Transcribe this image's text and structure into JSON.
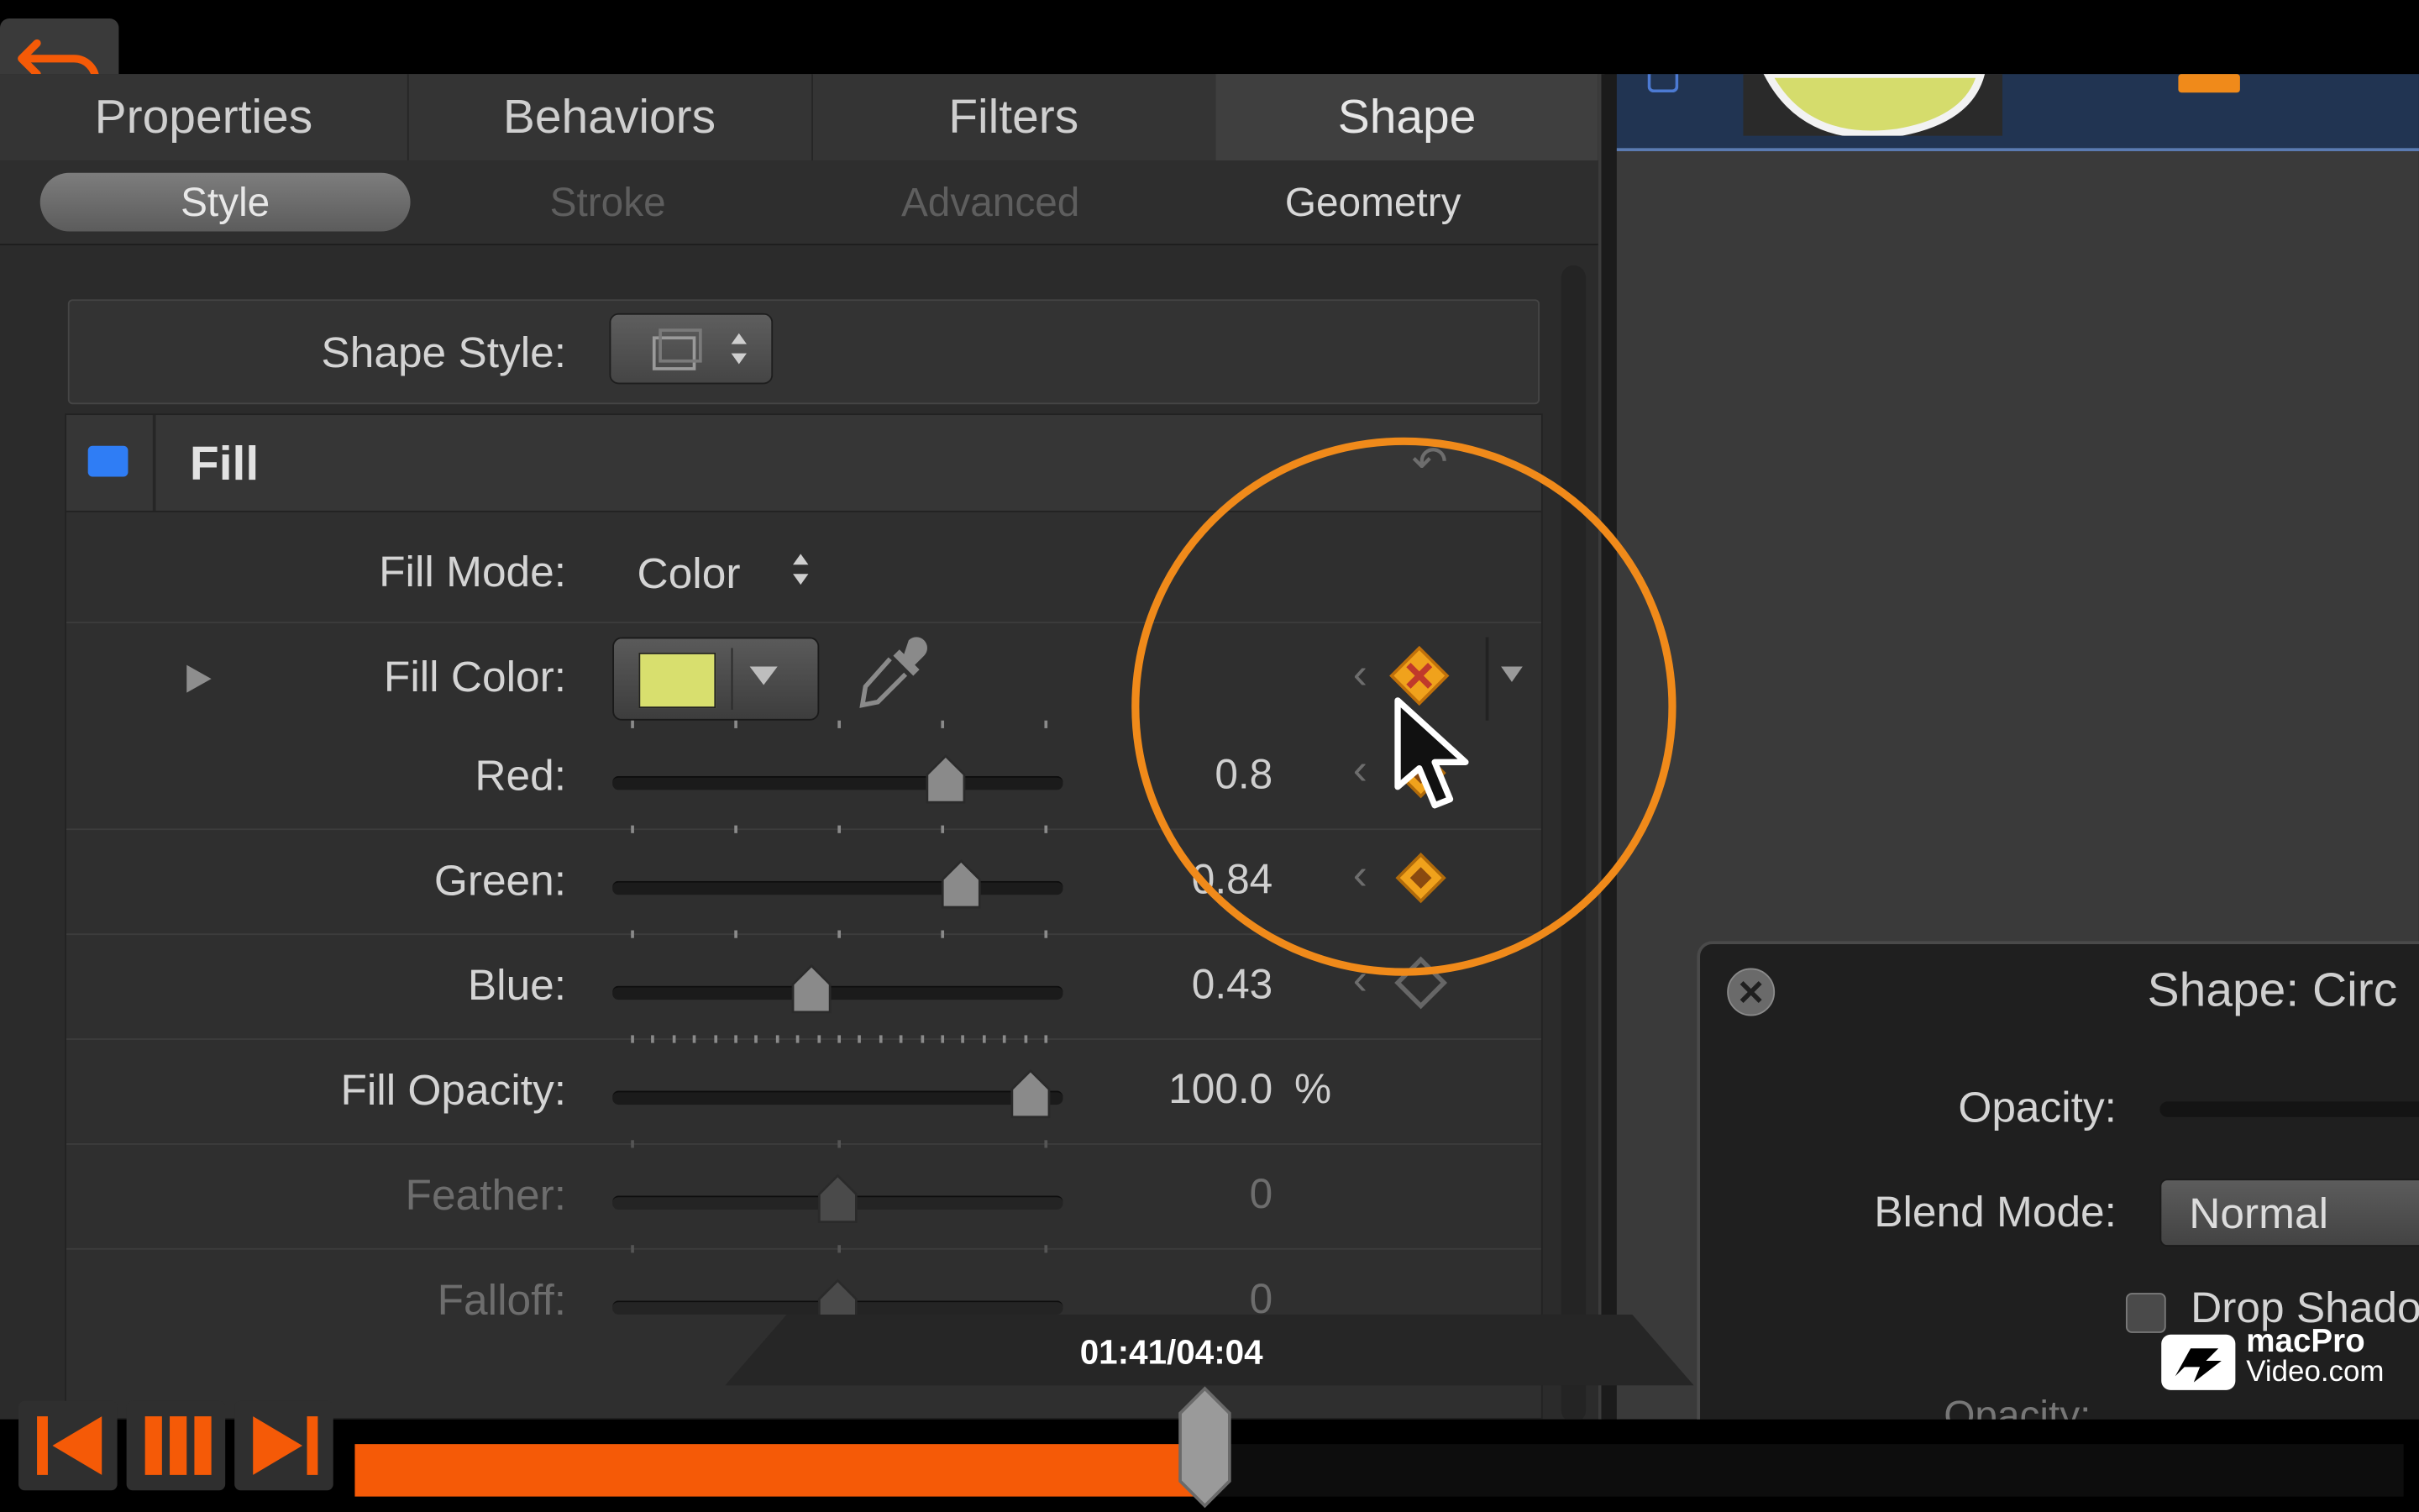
{
  "tabs": [
    "Properties",
    "Behaviors",
    "Filters",
    "Shape"
  ],
  "subtabs": [
    "Style",
    "Stroke",
    "Advanced",
    "Geometry"
  ],
  "shape_style_label": "Shape Style:",
  "fill": {
    "title": "Fill",
    "mode_label": "Fill Mode:",
    "mode_value": "Color",
    "color_label": "Fill Color:",
    "swatch_color": "#d8df6e",
    "rows": [
      {
        "label": "Red:",
        "value": "0.8",
        "level": 0.78
      },
      {
        "label": "Green:",
        "value": "0.84",
        "level": 0.82
      },
      {
        "label": "Blue:",
        "value": "0.43",
        "level": 0.43
      },
      {
        "label": "Fill Opacity:",
        "value": "100.0",
        "unit": "%",
        "level": 1.0
      },
      {
        "label": "Feather:",
        "value": "0",
        "level": 0.5
      },
      {
        "label": "Falloff:",
        "value": "0",
        "level": 0.5
      }
    ]
  },
  "hud": {
    "title": "Shape: Circ",
    "opacity_label": "Opacity:",
    "blend_label": "Blend Mode:",
    "blend_value": "Normal",
    "drop_shadow_label": "Drop Shado",
    "opacity2_label": "Opacity:"
  },
  "player": {
    "time": "01:41/04:04",
    "progress": 0.415
  },
  "logo": {
    "line1": "macPro",
    "line2": "Video.com"
  },
  "colors": {
    "accent": "#f55a07",
    "highlight_ring": "#f08a1a",
    "fill_checkbox": "#2f7df5"
  }
}
